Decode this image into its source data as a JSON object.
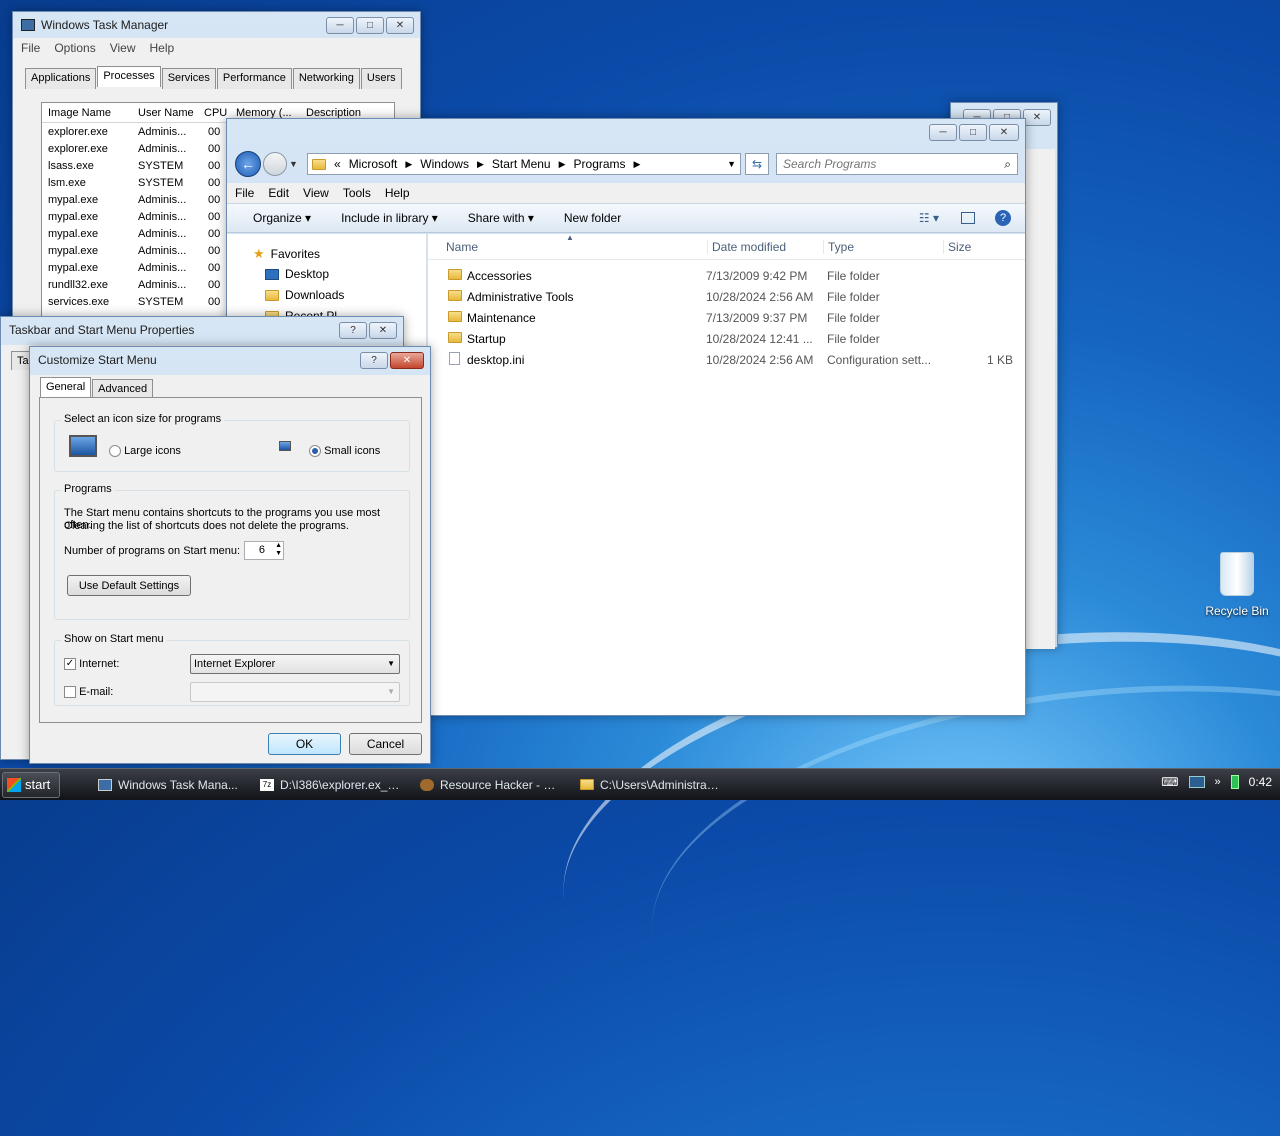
{
  "colors": {
    "desktop": "#1565c0",
    "window_frame": "#c1d6ee",
    "taskbar": "#1a1c20",
    "accent": "#3c7fb1"
  },
  "task_manager": {
    "title": "Windows Task Manager",
    "menu": [
      "File",
      "Options",
      "View",
      "Help"
    ],
    "tabs": [
      "Applications",
      "Processes",
      "Services",
      "Performance",
      "Networking",
      "Users"
    ],
    "columns": [
      "Image Name",
      "User Name",
      "CPU",
      "Memory (...",
      "Description"
    ],
    "rows": [
      {
        "name": "explorer.exe",
        "user": "Adminis...",
        "cpu": "00"
      },
      {
        "name": "explorer.exe",
        "user": "Adminis...",
        "cpu": "00"
      },
      {
        "name": "lsass.exe",
        "user": "SYSTEM",
        "cpu": "00"
      },
      {
        "name": "lsm.exe",
        "user": "SYSTEM",
        "cpu": "00"
      },
      {
        "name": "mypal.exe",
        "user": "Adminis...",
        "cpu": "00"
      },
      {
        "name": "mypal.exe",
        "user": "Adminis...",
        "cpu": "00"
      },
      {
        "name": "mypal.exe",
        "user": "Adminis...",
        "cpu": "00"
      },
      {
        "name": "mypal.exe",
        "user": "Adminis...",
        "cpu": "00"
      },
      {
        "name": "mypal.exe",
        "user": "Adminis...",
        "cpu": "00"
      },
      {
        "name": "rundll32.exe",
        "user": "Adminis...",
        "cpu": "00"
      },
      {
        "name": "services.exe",
        "user": "SYSTEM",
        "cpu": "00"
      }
    ]
  },
  "explorer": {
    "breadcrumb": [
      "«",
      "Microsoft",
      "Windows",
      "Start Menu",
      "Programs"
    ],
    "search_placeholder": "Search Programs",
    "menu": [
      "File",
      "Edit",
      "View",
      "Tools",
      "Help"
    ],
    "toolbar": {
      "organize": "Organize",
      "include": "Include in library",
      "share": "Share with",
      "new_folder": "New folder"
    },
    "nav": {
      "favorites": "Favorites",
      "desktop": "Desktop",
      "downloads": "Downloads",
      "recent": "Recent Pl..."
    },
    "columns": {
      "name": "Name",
      "date": "Date modified",
      "type": "Type",
      "size": "Size"
    },
    "files": [
      {
        "name": "Accessories",
        "date": "7/13/2009 9:42 PM",
        "type": "File folder",
        "size": "",
        "kind": "folder"
      },
      {
        "name": "Administrative Tools",
        "date": "10/28/2024 2:56 AM",
        "type": "File folder",
        "size": "",
        "kind": "folder"
      },
      {
        "name": "Maintenance",
        "date": "7/13/2009 9:37 PM",
        "type": "File folder",
        "size": "",
        "kind": "folder"
      },
      {
        "name": "Startup",
        "date": "10/28/2024 12:41 ...",
        "type": "File folder",
        "size": "",
        "kind": "folder"
      },
      {
        "name": "desktop.ini",
        "date": "10/28/2024 2:56 AM",
        "type": "Configuration sett...",
        "size": "1 KB",
        "kind": "file"
      }
    ]
  },
  "taskbar_props": {
    "title": "Taskbar and Start Menu Properties",
    "help": "?",
    "tab_fragment": "Ta"
  },
  "customize": {
    "title": "Customize Start Menu",
    "help": "?",
    "tabs": [
      "General",
      "Advanced"
    ],
    "icon_group": {
      "label": "Select an icon size for programs",
      "large": "Large icons",
      "small": "Small icons",
      "selected": "small"
    },
    "programs_group": {
      "label": "Programs",
      "text1": "The Start menu contains shortcuts to the programs you use most often.",
      "text2": "Clearing the list of shortcuts does not delete the programs.",
      "count_label": "Number of programs on Start menu:",
      "count": "6",
      "default_btn": "Use Default Settings"
    },
    "show_group": {
      "label": "Show on Start menu",
      "internet_label": "Internet:",
      "internet_checked": "✓",
      "internet_value": "Internet Explorer",
      "email_label": "E-mail:"
    },
    "ok": "OK",
    "cancel": "Cancel"
  },
  "desktop": {
    "recycle_bin": "Recycle Bin"
  },
  "taskbar": {
    "start": "start",
    "tasks": [
      "Windows Task Mana...",
      "D:\\I386\\explorer.ex_\\...",
      "Resource Hacker - M...",
      "C:\\Users\\Administrat..."
    ],
    "clock": "0:42"
  }
}
